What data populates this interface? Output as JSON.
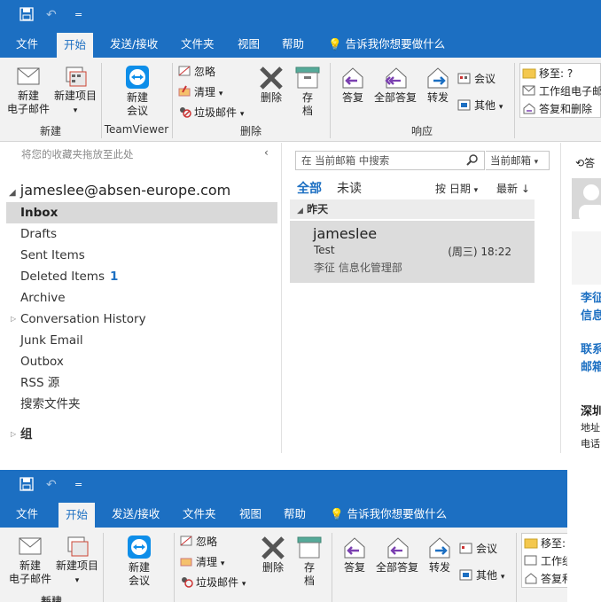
{
  "qat": {
    "save_icon": "save-icon",
    "undo_icon": "undo-icon",
    "customize": "="
  },
  "tabs": [
    "文件",
    "开始",
    "发送/接收",
    "文件夹",
    "视图",
    "帮助"
  ],
  "tell_me": "告诉我你想要做什么",
  "ribbon": {
    "new_email": [
      "新建",
      "电子邮件"
    ],
    "new_items": "新建项目",
    "group_new": "新建",
    "new_meeting": [
      "新建",
      "会议"
    ],
    "group_teamviewer": "TeamViewer",
    "ignore": "忽略",
    "cleanup": "清理",
    "junk": "垃圾邮件",
    "delete": "删除",
    "archive": [
      "存",
      "档"
    ],
    "group_delete": "删除",
    "reply": "答复",
    "reply_all": "全部答复",
    "forward": "转发",
    "meeting": "会议",
    "more": "其他",
    "group_respond": "响应",
    "move_to": "移至: ?",
    "team_email": "工作组电子邮件",
    "reply_delete": "答复和删除"
  },
  "folder_pane": {
    "fav_hint": "将您的收藏夹拖放至此处",
    "account": "jameslee@absen-europe.com",
    "folders": [
      {
        "name": "Inbox",
        "count": ""
      },
      {
        "name": "Drafts",
        "count": ""
      },
      {
        "name": "Sent Items",
        "count": ""
      },
      {
        "name": "Deleted Items",
        "count": "1"
      },
      {
        "name": "Archive",
        "count": ""
      },
      {
        "name": "Conversation History",
        "count": ""
      },
      {
        "name": "Junk Email",
        "count": ""
      },
      {
        "name": "Outbox",
        "count": ""
      },
      {
        "name": "RSS 源",
        "count": ""
      },
      {
        "name": "搜索文件夹",
        "count": ""
      }
    ],
    "group": "组"
  },
  "msg_list": {
    "search_placeholder": "在 当前邮箱 中搜索",
    "scope": "当前邮箱",
    "tab_all": "全部",
    "tab_unread": "未读",
    "sort_by": "按 日期",
    "sort_order": "最新 ↓",
    "group_header": "昨天",
    "message": {
      "from": "jameslee",
      "subject": "Test",
      "time": "(周三) 18:22",
      "preview": "李征  信息化管理部"
    }
  },
  "reading": {
    "reply_label": "答",
    "l1": "李征",
    "l2": "信息",
    "l3": "联系",
    "l4": "邮箱",
    "l5": "深圳",
    "l6": "地址",
    "l7": "电话"
  },
  "colors": {
    "accent": "#1c6fc2",
    "selected": "#d9d9d9"
  }
}
